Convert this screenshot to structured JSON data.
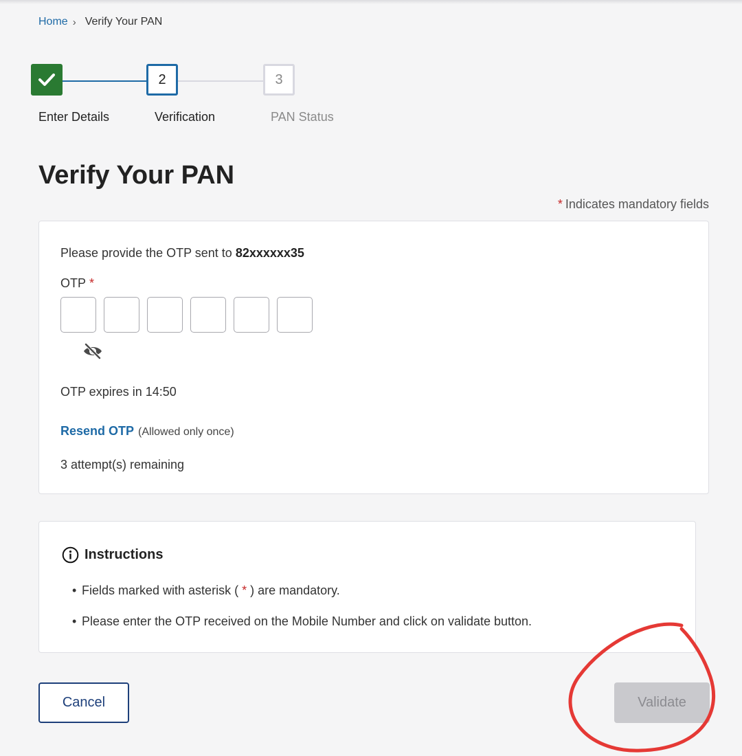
{
  "breadcrumb": {
    "home": "Home",
    "separator": "›",
    "current": "Verify Your PAN"
  },
  "stepper": {
    "steps": [
      {
        "number": "",
        "label": "Enter Details",
        "state": "completed"
      },
      {
        "number": "2",
        "label": "Verification",
        "state": "active"
      },
      {
        "number": "3",
        "label": "PAN Status",
        "state": "pending"
      }
    ]
  },
  "page": {
    "title": "Verify Your PAN",
    "mandatory_star": "*",
    "mandatory_note": "Indicates mandatory fields"
  },
  "otp": {
    "prompt": "Please provide the OTP sent to",
    "mobile": "82xxxxxx35",
    "label": "OTP",
    "required_star": "*",
    "digits": [
      "",
      "",
      "",
      "",
      "",
      ""
    ],
    "expiry": "OTP expires in 14:50",
    "resend_link": "Resend OTP",
    "resend_note": "(Allowed only once)",
    "attempts": "3 attempt(s) remaining"
  },
  "instructions": {
    "title": "Instructions",
    "item1_before": "Fields marked with asterisk (",
    "item1_star": " * ",
    "item1_after": ") are mandatory.",
    "item2": "Please enter the OTP received on the Mobile Number and click on validate button."
  },
  "actions": {
    "cancel": "Cancel",
    "validate": "Validate"
  },
  "colors": {
    "primary": "#1e6aa6",
    "success": "#2a7a32",
    "required": "#c62828",
    "annotation": "#e53935",
    "disabled": "#c9c9cd"
  },
  "icons": {
    "step1": "check-icon",
    "otp_visibility": "eye-off-icon",
    "instructions": "info-circle-icon"
  }
}
